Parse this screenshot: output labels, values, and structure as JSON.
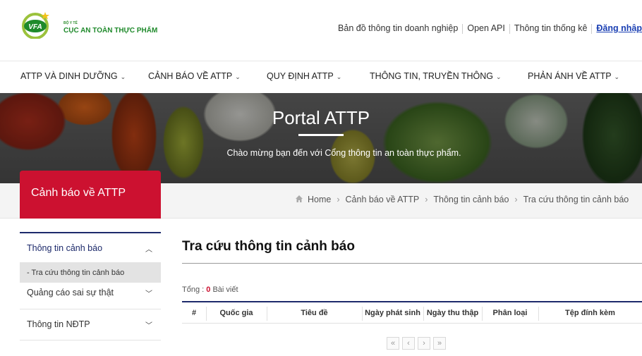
{
  "header": {
    "logo": {
      "mark": "VFA",
      "ministry": "BỘ Y TẾ",
      "agency": "CỤC AN TOÀN THỰC PHẨM"
    },
    "links": [
      {
        "label": "Bản đồ thông tin doanh nghiệp"
      },
      {
        "label": "Open API"
      },
      {
        "label": "Thông tin thống kê"
      },
      {
        "label": "Đăng nhập"
      }
    ]
  },
  "nav": {
    "items": [
      {
        "label": "ATTP và dinh dưỡng"
      },
      {
        "label": "Cảnh báo về ATTP"
      },
      {
        "label": "Quy định ATTP"
      },
      {
        "label": "Thông tin, truyền thông"
      },
      {
        "label": "Phản ánh về ATTP"
      }
    ]
  },
  "banner": {
    "title": "Portal ATTP",
    "subtitle": "Chào mừng bạn đến với Cổng thông tin an toàn thực phẩm."
  },
  "section": {
    "label": "Cảnh báo về ATTP"
  },
  "breadcrumb": {
    "items": [
      "Home",
      "Cảnh báo về ATTP",
      "Thông tin cảnh báo",
      "Tra cứu thông tin cảnh báo"
    ]
  },
  "sidebar": {
    "items": [
      {
        "label": "Thông tin cảnh báo",
        "expanded": true,
        "sub": [
          "Tra cứu thông tin cảnh báo"
        ]
      },
      {
        "label": "Quảng cáo sai sự thật"
      },
      {
        "label": "Thông tin NĐTP"
      }
    ]
  },
  "main": {
    "title": "Tra cứu thông tin cảnh báo",
    "total_label": "Tổng :",
    "total_count": "0",
    "total_unit": "Bài viết",
    "columns": [
      "#",
      "Quốc gia",
      "Tiêu đề",
      "Ngày phát sinh",
      "Ngày thu thập",
      "Phân loại",
      "Tệp đính kèm"
    ],
    "pager": [
      "«",
      "‹",
      "›",
      "»"
    ]
  },
  "colors": {
    "accent_red": "#cc1130",
    "navy": "#1d2a6b",
    "brand_green": "#1f8a2b",
    "link_blue": "#1a3fb3"
  }
}
